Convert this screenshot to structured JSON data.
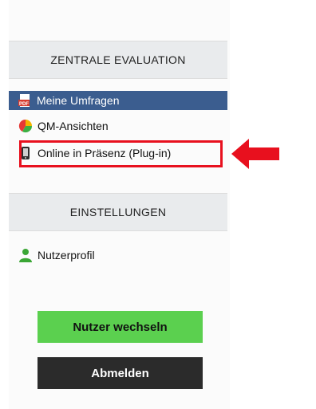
{
  "sections": {
    "evaluation": {
      "title": "ZENTRALE EVALUATION",
      "items": [
        {
          "label": "Meine Umfragen",
          "icon": "pdf-icon",
          "active": true
        },
        {
          "label": "QM-Ansichten",
          "icon": "pie-chart-icon",
          "active": false
        },
        {
          "label": "Online in Präsenz (Plug-in)",
          "icon": "mobile-phone-icon",
          "active": false
        }
      ]
    },
    "settings": {
      "title": "EINSTELLUNGEN",
      "items": [
        {
          "label": "Nutzerprofil",
          "icon": "user-icon"
        }
      ]
    }
  },
  "buttons": {
    "switch_user": "Nutzer wechseln",
    "logout": "Abmelden"
  },
  "colors": {
    "active_item_bg": "#3b5d8f",
    "highlight": "#e8101e",
    "green_button": "#5bd04f",
    "dark_button": "#2b2b2b"
  }
}
